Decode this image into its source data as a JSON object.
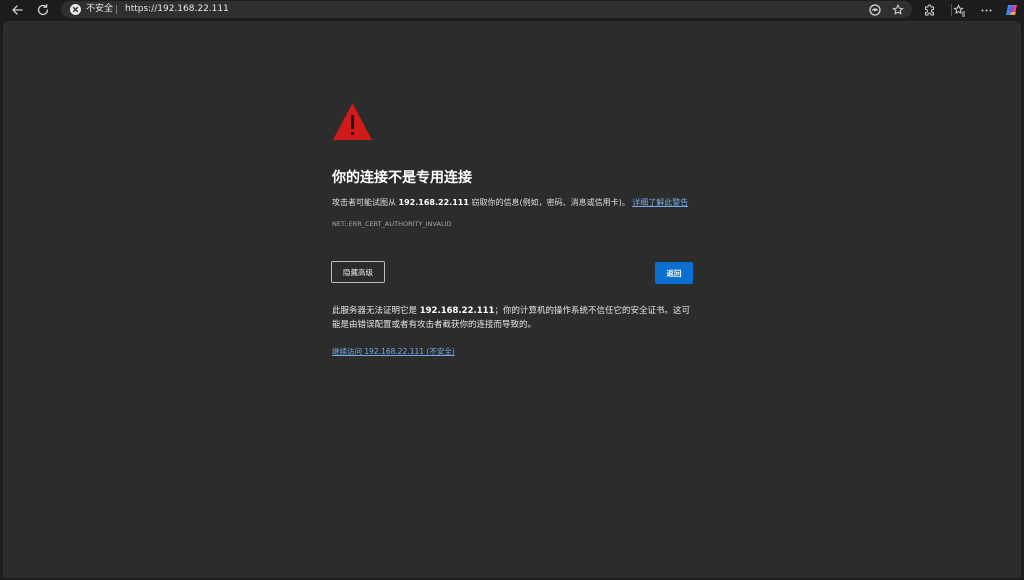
{
  "browser": {
    "security_label": "不安全",
    "url": "https://192.168.22.111"
  },
  "page": {
    "title": "你的连接不是专用连接",
    "desc_prefix": "攻击者可能试图从",
    "host": "192.168.22.111",
    "desc_suffix": "窃取你的信息(例如，密码、消息或信用卡)。",
    "learn_more_link": "详细了解此警告",
    "error_code": "NET::ERR_CERT_AUTHORITY_INVALID",
    "advanced_button": "隐藏高级",
    "back_button": "返回",
    "detail_prefix": "此服务器无法证明它是",
    "detail_host": "192.168.22.111",
    "detail_suffix": "；你的计算机的操作系统不信任它的安全证书。这可能是由错误配置或者有攻击者截获你的连接而导致的。",
    "proceed_link": "继续访问 192.168.22.111 (不安全)"
  },
  "colors": {
    "warning": "#d11a1a",
    "link": "#73a9e6",
    "primary_button": "#0a6fd0"
  }
}
